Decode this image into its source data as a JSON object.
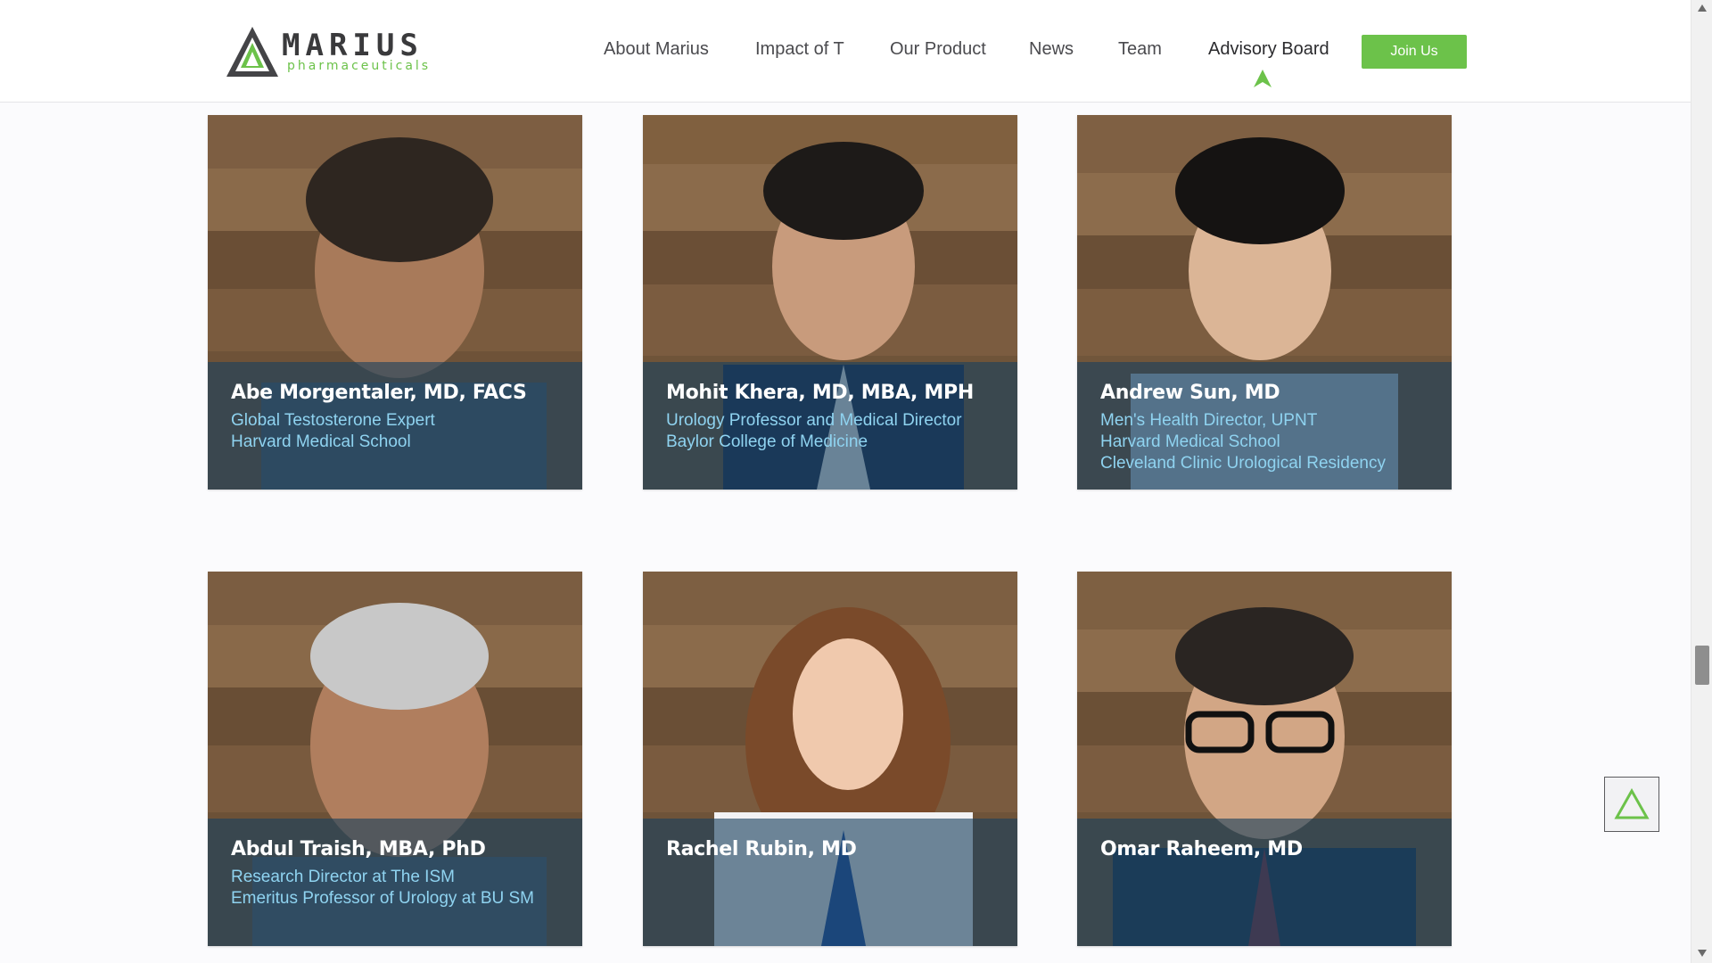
{
  "logo": {
    "word": "MARIUS",
    "sub": "pharmaceuticals"
  },
  "nav": {
    "items": [
      {
        "label": "About Marius"
      },
      {
        "label": "Impact of T"
      },
      {
        "label": "Our Product"
      },
      {
        "label": "News"
      },
      {
        "label": "Team"
      },
      {
        "label": "Advisory Board",
        "active": true
      }
    ],
    "join_label": "Join Us"
  },
  "cards": [
    {
      "name": "Abe Morgentaler, MD, FACS",
      "lines": [
        "Global Testosterone Expert",
        "Harvard Medical School"
      ]
    },
    {
      "name": "Mohit Khera, MD, MBA, MPH",
      "lines": [
        "Urology Professor and Medical Director",
        "Baylor College of Medicine"
      ]
    },
    {
      "name": "Andrew Sun, MD",
      "lines": [
        "Men's Health Director, UPNT",
        "Harvard Medical School",
        "Cleveland Clinic Urological Residency"
      ]
    },
    {
      "name": "Abdul Traish, MBA, PhD",
      "lines": [
        "Research Director at The ISM",
        "Emeritus Professor of Urology at BU SM"
      ]
    },
    {
      "name": "Rachel Rubin, MD",
      "lines": []
    },
    {
      "name": "Omar Raheem, MD",
      "lines": []
    }
  ],
  "colors": {
    "accent": "#6cc24a",
    "overlay": "#1a405e",
    "role_text": "#8fd3f0"
  },
  "icons": {
    "scroll_to_top": "triangle-up-icon",
    "active_nav": "triangle-up-icon"
  }
}
